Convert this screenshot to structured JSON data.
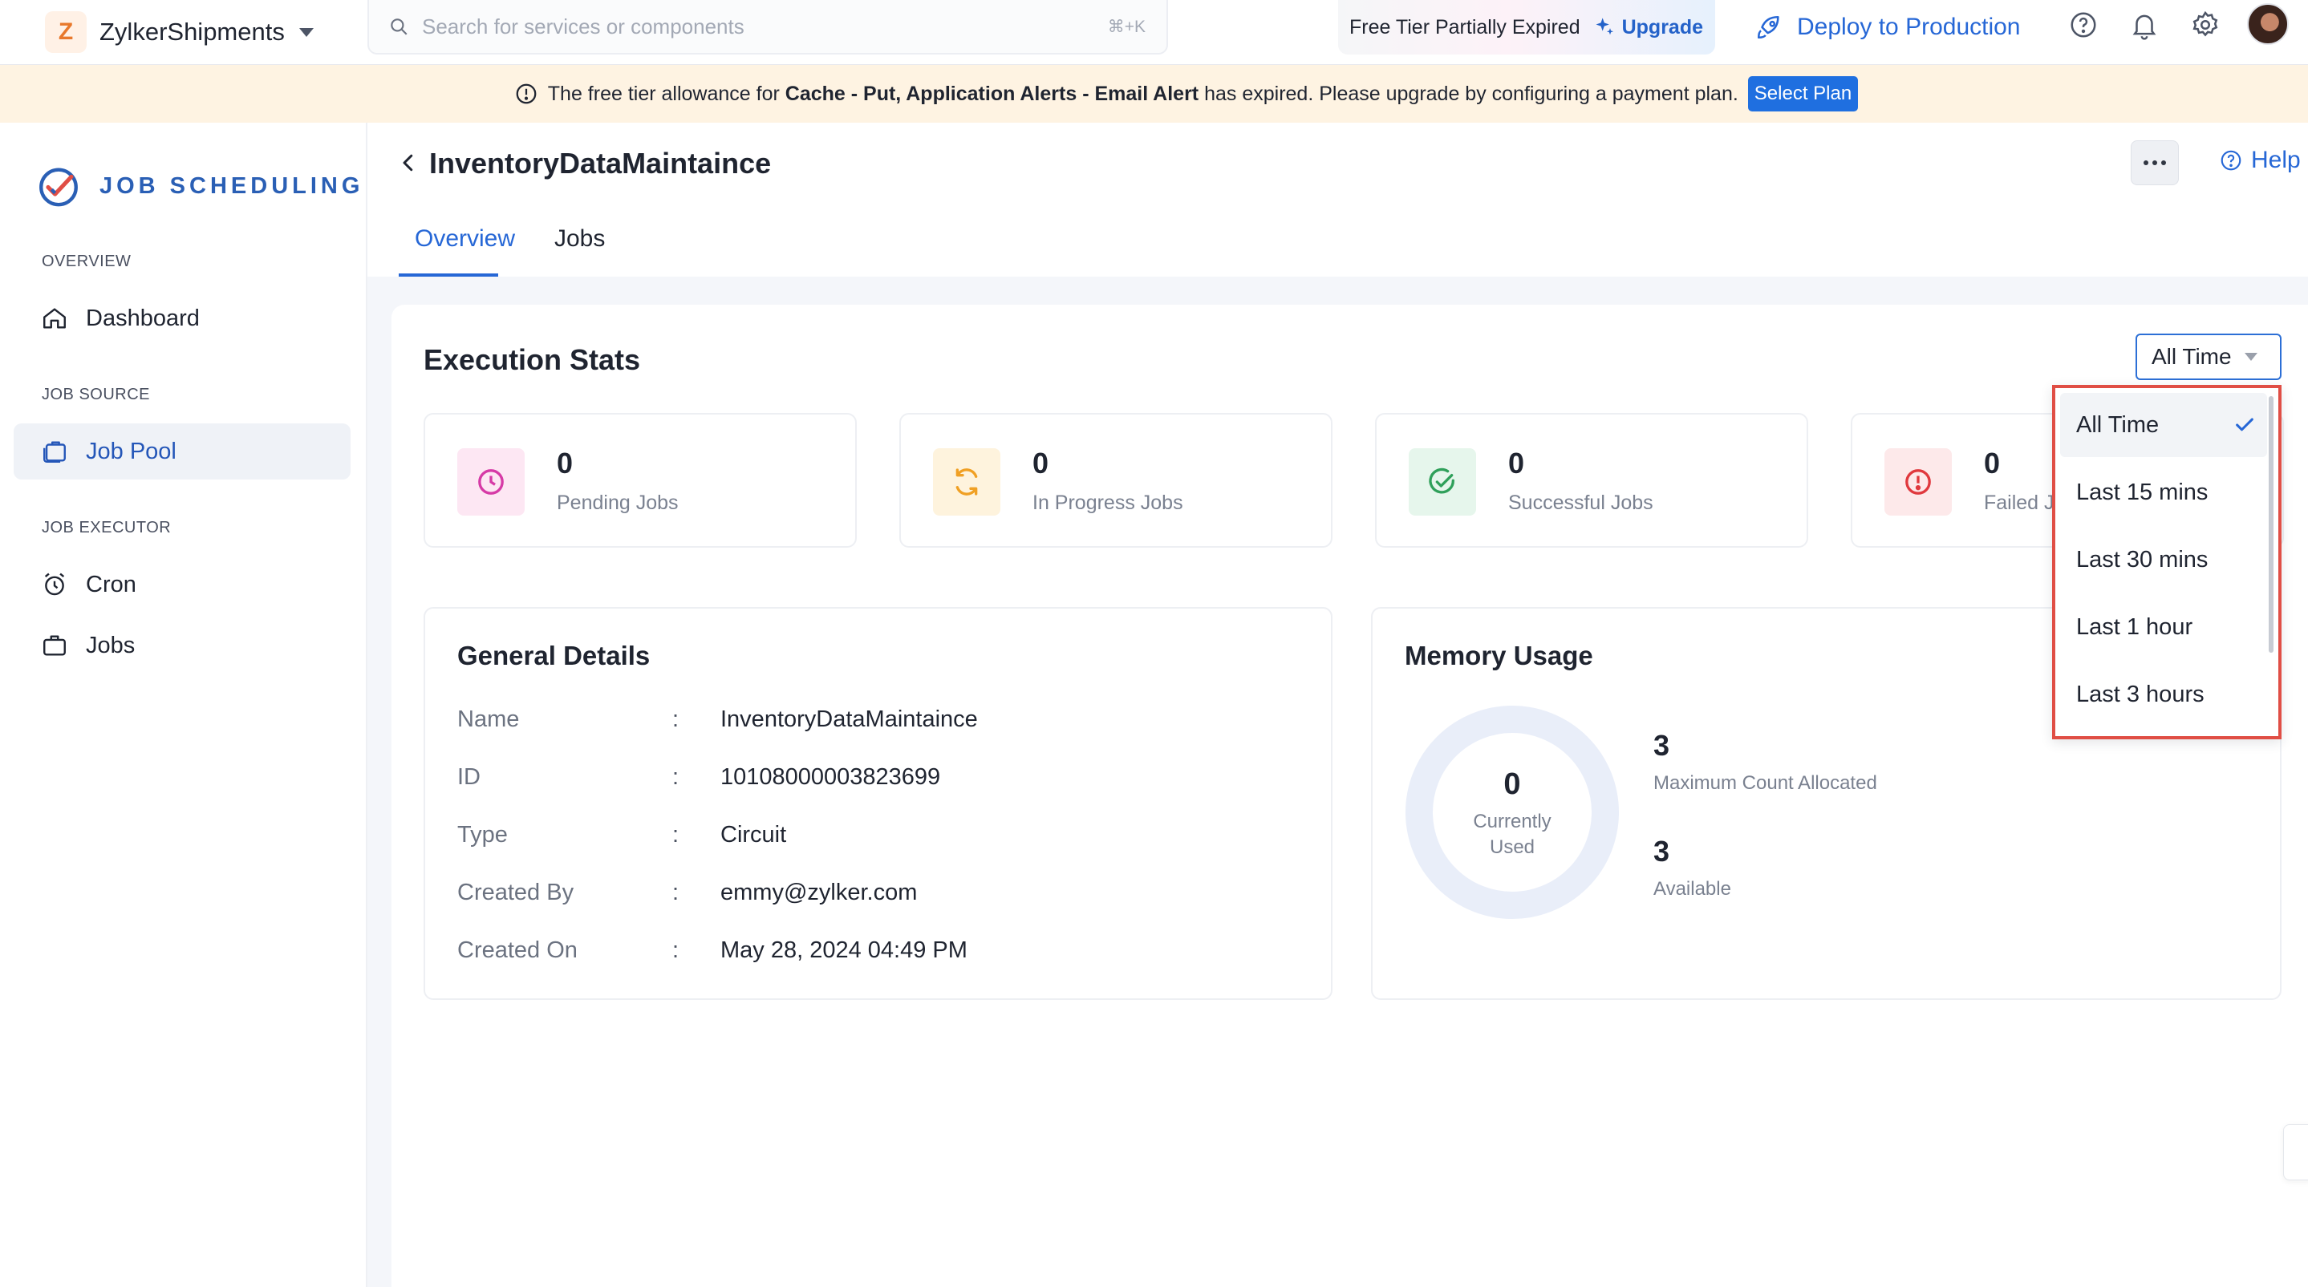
{
  "topbar": {
    "org_initial": "Z",
    "org_name": "ZylkerShipments",
    "search_placeholder": "Search for services or components",
    "search_shortcut": "⌘+K",
    "tier_text": "Free Tier Partially Expired",
    "upgrade_label": "Upgrade",
    "deploy_label": "Deploy to Production"
  },
  "banner": {
    "text_before": "The free tier allowance for ",
    "text_bold": "Cache - Put, Application Alerts - Email Alert",
    "text_after": " has expired. Please upgrade by configuring a payment plan.",
    "button_label": "Select Plan"
  },
  "sidebar": {
    "brand": "JOB SCHEDULING",
    "sections": [
      {
        "label": "OVERVIEW",
        "items": [
          {
            "label": "Dashboard",
            "icon": "home-icon"
          }
        ]
      },
      {
        "label": "JOB SOURCE",
        "items": [
          {
            "label": "Job Pool",
            "icon": "job-pool-icon",
            "active": true
          }
        ]
      },
      {
        "label": "JOB EXECUTOR",
        "items": [
          {
            "label": "Cron",
            "icon": "alarm-clock-icon"
          },
          {
            "label": "Jobs",
            "icon": "briefcase-icon"
          }
        ]
      }
    ]
  },
  "header": {
    "title": "InventoryDataMaintaince",
    "help_label": "Help",
    "tabs": [
      {
        "label": "Overview",
        "active": true
      },
      {
        "label": "Jobs",
        "active": false
      }
    ]
  },
  "execution_stats": {
    "title": "Execution Stats",
    "range": "All Time",
    "stats": [
      {
        "value": "0",
        "label": "Pending Jobs",
        "icon": "clock-icon",
        "color": "#d63aa6",
        "bg": "#fde7f3"
      },
      {
        "value": "0",
        "label": "In Progress Jobs",
        "icon": "refresh-icon",
        "color": "#f0a024",
        "bg": "#fef3dd"
      },
      {
        "value": "0",
        "label": "Successful Jobs",
        "icon": "check-circle-icon",
        "color": "#2fa05a",
        "bg": "#e6f6ec"
      },
      {
        "value": "0",
        "label": "Failed Jobs",
        "icon": "alert-circle-icon",
        "color": "#e0393e",
        "bg": "#fde9ea"
      }
    ]
  },
  "general_details": {
    "title": "General Details",
    "rows": [
      {
        "key": "Name",
        "value": "InventoryDataMaintaince"
      },
      {
        "key": "ID",
        "value": "10108000003823699"
      },
      {
        "key": "Type",
        "value": "Circuit"
      },
      {
        "key": "Created By",
        "value": "emmy@zylker.com"
      },
      {
        "key": "Created On",
        "value": "May 28, 2024 04:49 PM"
      }
    ]
  },
  "memory_usage": {
    "title": "Memory Usage",
    "currently_used_value": "0",
    "currently_used_label_1": "Currently",
    "currently_used_label_2": "Used",
    "max_value": "3",
    "max_label": "Maximum Count Allocated",
    "available_value": "3",
    "available_label": "Available",
    "used_fraction": 0
  },
  "range_dropdown": {
    "options": [
      "All Time",
      "Last 15 mins",
      "Last 30 mins",
      "Last 1 hour",
      "Last 3 hours"
    ],
    "selected": "All Time"
  },
  "colors": {
    "accent": "#2667d6",
    "banner_bg": "#fef3e2",
    "highlight_border": "#e04e45"
  }
}
